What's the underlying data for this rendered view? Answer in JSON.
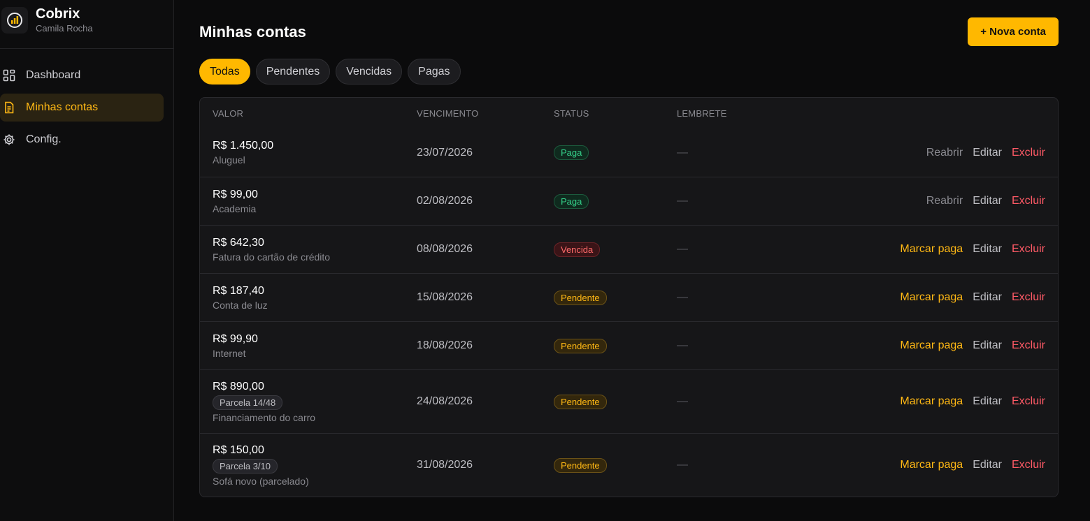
{
  "app": {
    "name": "Cobrix",
    "user": "Camila Rocha"
  },
  "sidebar": {
    "items": [
      {
        "label": "Dashboard",
        "icon": "dashboard-grid-icon",
        "active": false
      },
      {
        "label": "Minhas contas",
        "icon": "document-icon",
        "active": true
      },
      {
        "label": "Config.",
        "icon": "gear-icon",
        "active": false
      }
    ]
  },
  "page": {
    "title": "Minhas contas",
    "new_button": "+ Nova conta"
  },
  "tabs": [
    {
      "label": "Todas",
      "active": true
    },
    {
      "label": "Pendentes",
      "active": false
    },
    {
      "label": "Vencidas",
      "active": false
    },
    {
      "label": "Pagas",
      "active": false
    }
  ],
  "table": {
    "headers": {
      "valor": "VALOR",
      "vencimento": "VENCIMENTO",
      "status": "STATUS",
      "lembrete": "LEMBRETE"
    },
    "rows": [
      {
        "amount": "R$ 1.450,00",
        "installment": "",
        "desc": "Aluguel",
        "date": "23/07/2026",
        "status": "Paga",
        "status_kind": "paga",
        "reminder": "—",
        "primary_action": "Reabrir",
        "edit": "Editar",
        "delete": "Excluir"
      },
      {
        "amount": "R$ 99,00",
        "installment": "",
        "desc": "Academia",
        "date": "02/08/2026",
        "status": "Paga",
        "status_kind": "paga",
        "reminder": "—",
        "primary_action": "Reabrir",
        "edit": "Editar",
        "delete": "Excluir"
      },
      {
        "amount": "R$ 642,30",
        "installment": "",
        "desc": "Fatura do cartão de crédito",
        "date": "08/08/2026",
        "status": "Vencida",
        "status_kind": "vencida",
        "reminder": "—",
        "primary_action": "Marcar paga",
        "edit": "Editar",
        "delete": "Excluir"
      },
      {
        "amount": "R$ 187,40",
        "installment": "",
        "desc": "Conta de luz",
        "date": "15/08/2026",
        "status": "Pendente",
        "status_kind": "pendente",
        "reminder": "—",
        "primary_action": "Marcar paga",
        "edit": "Editar",
        "delete": "Excluir"
      },
      {
        "amount": "R$ 99,90",
        "installment": "",
        "desc": "Internet",
        "date": "18/08/2026",
        "status": "Pendente",
        "status_kind": "pendente",
        "reminder": "—",
        "primary_action": "Marcar paga",
        "edit": "Editar",
        "delete": "Excluir"
      },
      {
        "amount": "R$ 890,00",
        "installment": "Parcela 14/48",
        "desc": "Financiamento do carro",
        "date": "24/08/2026",
        "status": "Pendente",
        "status_kind": "pendente",
        "reminder": "—",
        "primary_action": "Marcar paga",
        "edit": "Editar",
        "delete": "Excluir"
      },
      {
        "amount": "R$ 150,00",
        "installment": "Parcela 3/10",
        "desc": "Sofá novo (parcelado)",
        "date": "31/08/2026",
        "status": "Pendente",
        "status_kind": "pendente",
        "reminder": "—",
        "primary_action": "Marcar paga",
        "edit": "Editar",
        "delete": "Excluir"
      }
    ]
  },
  "colors": {
    "accent": "#ffb800",
    "paid": "#35d08a",
    "overdue": "#ff6b6b",
    "danger": "#ff5a66"
  }
}
